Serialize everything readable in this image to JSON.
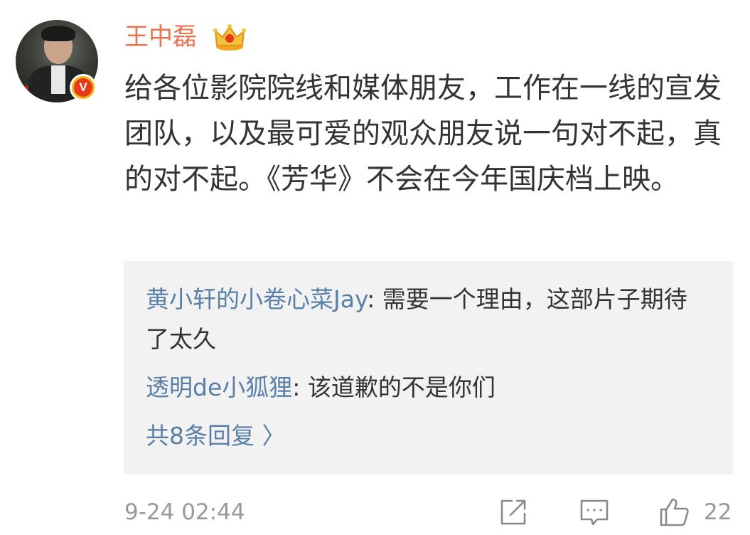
{
  "post": {
    "author": "王中磊",
    "text": "给各位影院院线和媒体朋友，工作在一线的宣发团队，以及最可爱的观众朋友说一句对不起，真的对不起。《芳华》不会在今年国庆档上映。",
    "timestamp": "9-24 02:44",
    "like_count": "22"
  },
  "badges": {
    "verified_letter": "V"
  },
  "replies": [
    {
      "user": "黄小轩的小卷心菜Jay",
      "text": ": 需要一个理由，这部片子期待了太久"
    },
    {
      "user": "透明de小狐狸",
      "text": ": 该道歉的不是你们"
    }
  ],
  "more_replies": "共8条回复 〉",
  "colors": {
    "name": "#eb7350",
    "link": "#5a80a8",
    "muted": "#999999",
    "reply_bg": "#f2f2f2",
    "text": "#333333"
  },
  "icons": {
    "share": "share-icon",
    "comment": "comment-icon",
    "like": "thumbs-up-icon"
  }
}
